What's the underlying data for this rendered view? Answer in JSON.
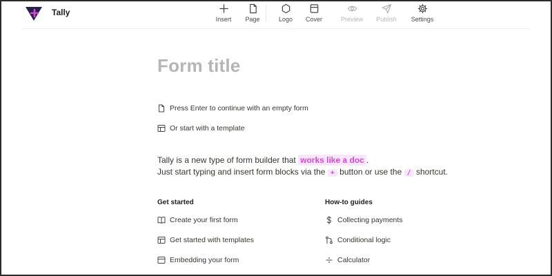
{
  "app": {
    "name": "Tally"
  },
  "toolbar": {
    "insert": "Insert",
    "page": "Page",
    "logo": "Logo",
    "cover": "Cover",
    "preview": "Preview",
    "publish": "Publish",
    "settings": "Settings"
  },
  "form": {
    "title_placeholder": "Form title"
  },
  "options": {
    "empty": "Press Enter to continue with an empty form",
    "template": "Or start with a template"
  },
  "intro": {
    "line1_prefix": "Tally is a new type of form builder that",
    "highlight": "works like a doc",
    "line1_suffix": ".",
    "line2_prefix": "Just start typing and insert form blocks via the",
    "plus_key": "+",
    "line2_middle": "button or use the",
    "slash_key": "/",
    "line2_suffix": "shortcut."
  },
  "get_started": {
    "heading": "Get started",
    "items": [
      "Create your first form",
      "Get started with templates",
      "Embedding your form"
    ]
  },
  "guides": {
    "heading": "How-to guides",
    "items": [
      "Collecting payments",
      "Conditional logic",
      "Calculator"
    ]
  },
  "colors": {
    "accent": "#d44ad8",
    "accent_bg": "#fbe7fb",
    "logo": "#2a1f4a"
  },
  "icons": {
    "insert": "plus-icon",
    "page": "page-icon",
    "logo": "hexagon-icon",
    "cover": "cover-icon",
    "preview": "eye-icon",
    "publish": "send-icon",
    "settings": "gear-icon"
  }
}
